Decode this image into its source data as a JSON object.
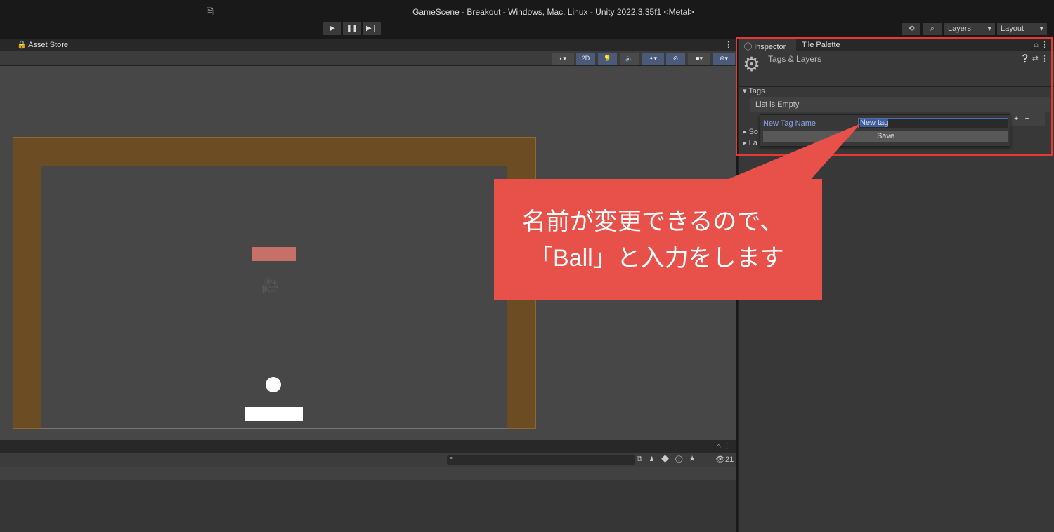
{
  "window": {
    "title": "GameScene - Breakout - Windows, Mac, Linux - Unity 2022.3.35f1 <Metal>"
  },
  "toolbar": {
    "play": "▶",
    "pause": "❚❚",
    "step": "▶❘",
    "history_icon": "history-icon",
    "search_icon": "search-icon",
    "layers": "Layers",
    "layout": "Layout"
  },
  "scene_tabs": {
    "asset_store": "Asset Store"
  },
  "scene_toolbar": {
    "mode_2d": "2D"
  },
  "inspector": {
    "tabs": [
      "Inspector",
      "Tile Palette"
    ],
    "header": "Tags & Layers",
    "tags_label": "Tags",
    "list_empty": "List is Empty",
    "sorting_layers": "So",
    "layers": "La",
    "popup": {
      "label": "New Tag Name",
      "value": "New tag",
      "save": "Save"
    }
  },
  "console": {
    "count": "21"
  },
  "callout": {
    "line1": "名前が変更できるので、",
    "line2": "「Ball」と入力をします"
  },
  "colors": {
    "accent_red": "#e53935",
    "callout": "#e8504a",
    "wall": "#6b4c23",
    "brick": "#c77068"
  }
}
